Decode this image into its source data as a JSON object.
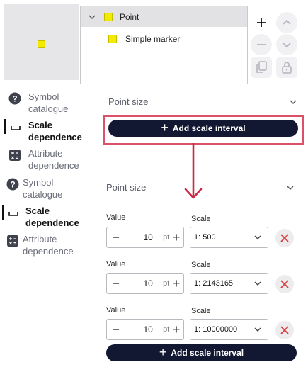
{
  "tree": {
    "root_label": "Point",
    "child_label": "Simple marker"
  },
  "toolbar": {
    "add_icon": "plus-icon",
    "up_icon": "chevron-up-icon",
    "remove_icon": "minus-icon",
    "down_icon": "chevron-down-icon",
    "duplicate_icon": "copy-icon",
    "lock_icon": "lock-icon"
  },
  "nav_top": [
    {
      "label_line1": "Symbol",
      "label_line2": "catalogue",
      "icon": "help-circle-icon",
      "active": false
    },
    {
      "label_line1": "Scale",
      "label_line2": "dependence",
      "icon": "scale-bracket-icon",
      "active": true
    },
    {
      "label_line1": "Attribute",
      "label_line2": "dependence",
      "icon": "calculator-icon",
      "active": false
    }
  ],
  "nav_bottom": [
    {
      "label_line1": "Symbol",
      "label_line2": "catalogue",
      "icon": "help-circle-icon",
      "active": false
    },
    {
      "label_line1": "Scale",
      "label_line2": "dependence",
      "icon": "scale-bracket-icon",
      "active": true
    },
    {
      "label_line1": "Attribute",
      "label_line2": "dependence",
      "icon": "calculator-icon",
      "active": false
    }
  ],
  "top_section": {
    "title": "Point size",
    "add_button": "Add scale interval"
  },
  "bottom_section": {
    "title": "Point size",
    "value_label": "Value",
    "scale_label": "Scale",
    "rows": [
      {
        "value": "10",
        "unit": "pt",
        "scale": "1: 500"
      },
      {
        "value": "10",
        "unit": "pt",
        "scale": "1: 2143165"
      },
      {
        "value": "10",
        "unit": "pt",
        "scale": "1: 10000000"
      }
    ],
    "add_button": "Add scale interval"
  },
  "colors": {
    "accent_dark": "#121831",
    "highlight": "#db5169",
    "marker_yellow": "#f2ea00",
    "delete_red": "#d93a3a"
  }
}
